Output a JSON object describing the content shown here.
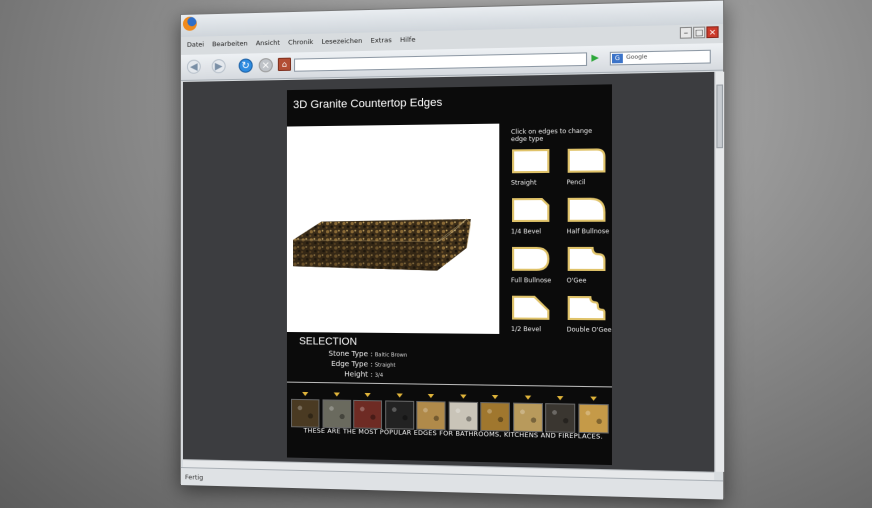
{
  "browser": {
    "menu": [
      "Datei",
      "Bearbeiten",
      "Ansicht",
      "Chronik",
      "Lesezeichen",
      "Extras",
      "Hilfe"
    ],
    "search_placeholder": "Google",
    "status": "Fertig"
  },
  "page": {
    "title": "3D Granite Countertop Edges",
    "hint": "Click on edges to change edge type",
    "edges": [
      {
        "label": "Straight"
      },
      {
        "label": "Pencil"
      },
      {
        "label": "1/4 Bevel"
      },
      {
        "label": "Half Bullnose"
      },
      {
        "label": "Full Bullnose"
      },
      {
        "label": "O'Gee"
      },
      {
        "label": "1/2 Bevel"
      },
      {
        "label": "Double O'Gee"
      }
    ],
    "selection": {
      "title": "SELECTION",
      "stone_type_label": "Stone Type :",
      "stone_type_value": "Baltic Brown",
      "edge_type_label": "Edge Type :",
      "edge_type_value": "Straight",
      "height_label": "Height :",
      "height_value": "3/4"
    },
    "swatch_colors": [
      "#4a3a22",
      "#6a6a5e",
      "#6e2b24",
      "#222222",
      "#b08a4a",
      "#c9c4b8",
      "#a0772e",
      "#b89a5c",
      "#3a3630",
      "#c59a48"
    ],
    "footer": "THESE ARE THE MOST POPULAR EDGES FOR BATHROOMS, KITCHENS AND FIREPLACES."
  }
}
